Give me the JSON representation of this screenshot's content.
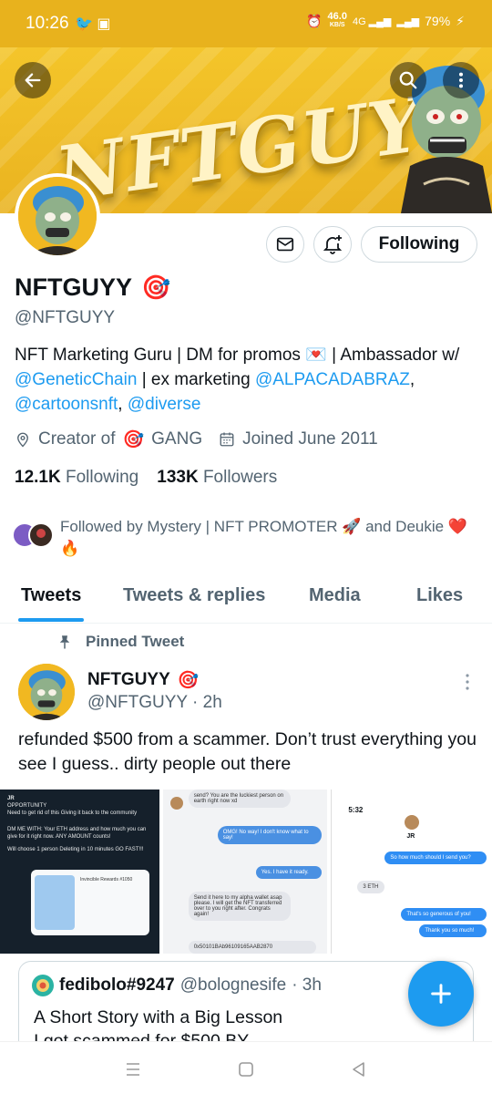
{
  "status_bar": {
    "time": "10:26",
    "network_speed": "46.0",
    "network_unit": "KB/S",
    "battery": "79%",
    "left_icons": "🐦 ▣",
    "right_icons": "⏰ 4G ▁▃▅"
  },
  "header": {
    "back_icon": "arrow-left-icon",
    "search_icon": "search-icon",
    "more_icon": "more-vertical-icon",
    "banner_text": "NFTGUYY"
  },
  "profile": {
    "name": "NFTGUYY",
    "name_emoji": "🎯",
    "handle": "@NFTGUYY",
    "bio_part1": "NFT Marketing Guru | DM for promos 💌 | Ambassador w/ ",
    "bio_link1": "@GeneticChain",
    "bio_part2": " | ex marketing  ",
    "bio_link2": "@ALPACADABRAZ",
    "bio_part3": ", ",
    "bio_link3": "@cartoonsnft",
    "bio_part4": ", ",
    "bio_link4": "@diverse",
    "location_prefix": "Creator of",
    "location_emoji": "🎯",
    "location_suffix": "GANG",
    "joined": "Joined June 2011",
    "following_count": "12.1K",
    "following_label": "Following",
    "followers_count": "133K",
    "followers_label": "Followers",
    "followed_by": "Followed by Mystery | NFT PROMOTER 🚀 and Deukie ❤️🔥"
  },
  "buttons": {
    "following": "Following"
  },
  "tabs": [
    "Tweets",
    "Tweets & replies",
    "Media",
    "Likes"
  ],
  "pinned_tweet": {
    "pinned_label": "Pinned Tweet",
    "author_name": "NFTGUYY",
    "author_emoji": "🎯",
    "author_handle": "@NFTGUYY",
    "time": "· 2h",
    "text": "refunded $500 from a scammer. Don’t trust everything you see I guess.. dirty people out there"
  },
  "media_chat": {
    "left_header": "JR",
    "right_time": "5:32",
    "right_name": "JR",
    "m2_msg1": "send? You are the luckiest person on earth right now xd",
    "m2_msg2": "OMG! No way! I don't know what to say!",
    "m2_msg3": "Yes. I have it ready.",
    "m2_msg4": "Send it here to my alpha wallet asap please. I will get the NFT transferred over to you right after. Congrats again!",
    "m2_msg5": "0x50101BAb96109165AAB2870",
    "m3_msg1": "So how much should I send you?",
    "m3_msg2": "3 ETH",
    "m3_msg3": "That's so generous of you!",
    "m3_msg4": "Thank you so much!",
    "m1_title": "OPPORTUNITY",
    "m1_text": "Need to get rid of this Giving it back to the community",
    "m1_dm": "DM ME WITH: Your ETH address and how much you can give for it right now. ANY AMOUNT counts!",
    "m1_winner": "Will choose 1 person Deleting in 10 minutes GO FAST!!!",
    "m1_card": "Invincible Rewards #1050"
  },
  "quoted_tweet": {
    "author_name": "fedibolo#9247",
    "author_handle": "@bolognesife",
    "time": "· 3h",
    "text_line1": "A Short Story with a Big Lesson",
    "text_line2": "I got scammed for $500 BY"
  },
  "colors": {
    "accent": "#1d9bf0",
    "banner": "#f1b821",
    "text": "#0f1419",
    "muted": "#536471"
  }
}
